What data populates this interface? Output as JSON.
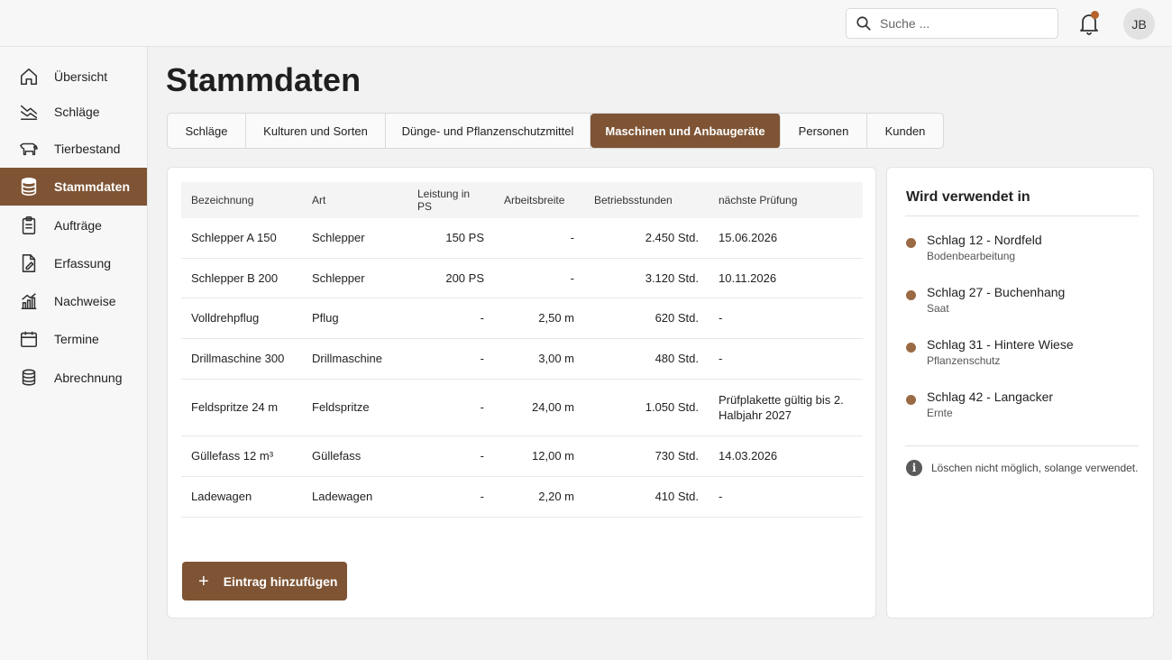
{
  "header": {
    "search_placeholder": "Suche ...",
    "notification_indicator_color": "#b5642b",
    "user_initials": "JB"
  },
  "sidebar": {
    "items": [
      {
        "label": "Übersicht",
        "icon": "home-icon"
      },
      {
        "label": "Schläge",
        "icon": "field-icon"
      },
      {
        "label": "Tierbestand",
        "icon": "cow-icon"
      },
      {
        "label": "Stammdaten",
        "icon": "database-icon",
        "active": true
      },
      {
        "label": "Aufträge",
        "icon": "clipboard-icon"
      },
      {
        "label": "Erfassung",
        "icon": "edit-document-icon"
      },
      {
        "label": "Nachweise",
        "icon": "chart-icon"
      },
      {
        "label": "Termine",
        "icon": "calendar-icon"
      },
      {
        "label": "Abrechnung",
        "icon": "coins-icon"
      }
    ]
  },
  "main": {
    "title": "Stammdaten",
    "tabs": [
      {
        "label": "Schläge"
      },
      {
        "label": "Kulturen und Sorten"
      },
      {
        "label": "Dünge- und Pflanzenschutzmittel"
      },
      {
        "label": "Maschinen und Anbaugeräte",
        "active": true
      },
      {
        "label": "Personen"
      },
      {
        "label": "Kunden"
      }
    ],
    "table": {
      "columns": [
        "Bezeichnung",
        "Art",
        "Leistung in PS",
        "Arbeitsbreite",
        "Betriebsstunden",
        "nächste Prüfung"
      ],
      "rows": [
        [
          "Schlepper A 150",
          "Schlepper",
          "150 PS",
          "-",
          "2.450 Std.",
          "15.06.2026"
        ],
        [
          "Schlepper B 200",
          "Schlepper",
          "200 PS",
          "-",
          "3.120 Std.",
          "10.11.2026"
        ],
        [
          "Volldrehpflug",
          "Pflug",
          "-",
          "2,50 m",
          "620 Std.",
          "-"
        ],
        [
          "Drillmaschine 300",
          "Drillmaschine",
          "-",
          "3,00 m",
          "480 Std.",
          "-"
        ],
        [
          "Feldspritze 24 m",
          "Feldspritze",
          "-",
          "24,00 m",
          "1.050 Std.",
          "Prüfplakette gültig bis 2. Halbjahr 2027"
        ],
        [
          "Güllefass 12 m³",
          "Güllefass",
          "-",
          "12,00 m",
          "730 Std.",
          "14.03.2026"
        ],
        [
          "Ladewagen",
          "Ladewagen",
          "-",
          "2,20 m",
          "410 Std.",
          "-"
        ]
      ]
    },
    "add_button_label": "Eintrag hinzufügen"
  },
  "usage_panel": {
    "title": "Wird verwendet in",
    "items": [
      {
        "title": "Schlag 12 - Nordfeld",
        "subtitle": "Bodenbearbeitung"
      },
      {
        "title": "Schlag 27 - Buchenhang",
        "subtitle": "Saat"
      },
      {
        "title": "Schlag 31 - Hintere Wiese",
        "subtitle": "Pflanzenschutz"
      },
      {
        "title": "Schlag 42 - Langacker",
        "subtitle": "Ernte"
      }
    ],
    "note": "Löschen nicht möglich, solange verwendet."
  },
  "colors": {
    "accent": "#7e5434",
    "usage_dot": "#9a6a44"
  }
}
